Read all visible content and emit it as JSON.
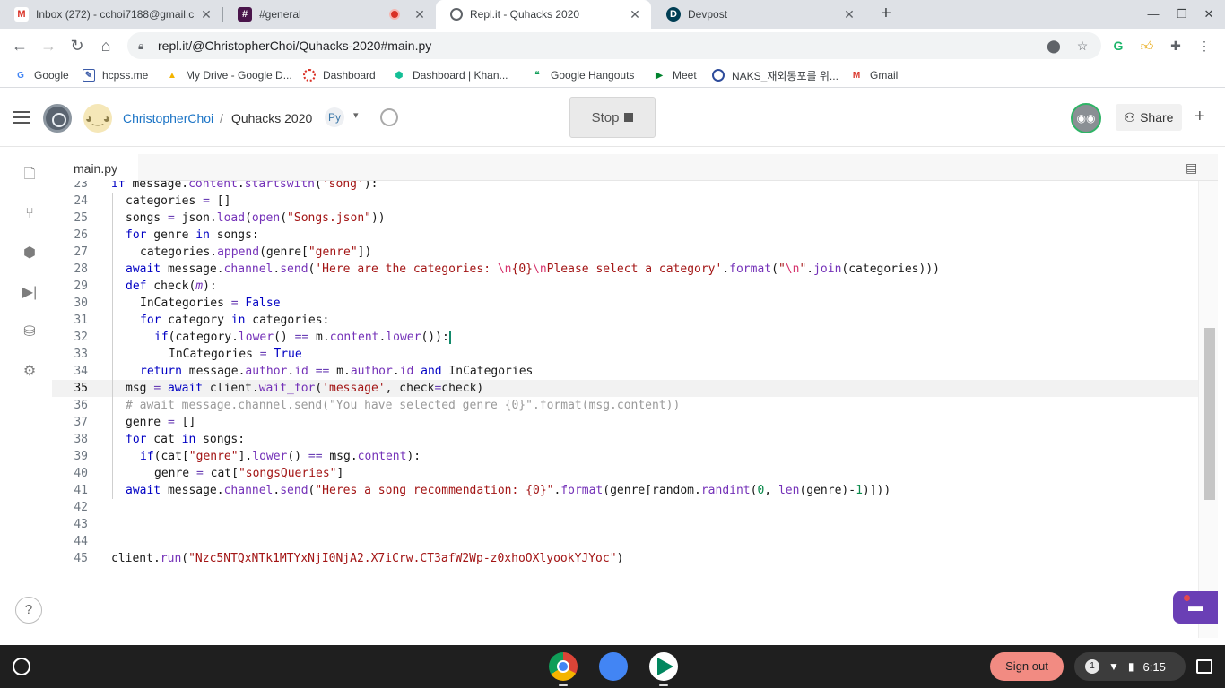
{
  "browser": {
    "tabs": [
      {
        "title": "Inbox (272) - cchoi7188@gmail.c"
      },
      {
        "title": "#general"
      },
      {
        "title": "Repl.it - Quhacks 2020"
      },
      {
        "title": "Devpost"
      }
    ],
    "url": "repl.it/@ChristopherChoi/Quhacks-2020#main.py",
    "bookmarks": [
      {
        "label": "Google"
      },
      {
        "label": "hcpss.me"
      },
      {
        "label": "My Drive - Google D..."
      },
      {
        "label": "Dashboard"
      },
      {
        "label": "Dashboard | Khan..."
      },
      {
        "label": "Google Hangouts"
      },
      {
        "label": "Meet"
      },
      {
        "label": "NAKS_재외동포를 위..."
      },
      {
        "label": "Gmail"
      }
    ],
    "colors": {
      "tabstrip": "#dee1e6",
      "active_tab": "#ffffff"
    }
  },
  "repl": {
    "username": "ChristopherChoi",
    "separator": "/",
    "project": "Quhacks 2020",
    "stop_label": "Stop",
    "share_label": "Share",
    "file_tab": "main.py",
    "accent": "#1a73c5"
  },
  "editor": {
    "current_line": "35",
    "lines": [
      {
        "num": "23",
        "text": "if message.content.startswith('song'):"
      },
      {
        "num": "24",
        "text": "categories = []"
      },
      {
        "num": "25",
        "text": "songs = json.load(open(\"Songs.json\"))"
      },
      {
        "num": "26",
        "text": "for genre in songs:"
      },
      {
        "num": "27",
        "text": "categories.append(genre[\"genre\"])"
      },
      {
        "num": "28",
        "text": "await message.channel.send('Here are the categories: \\n{0}\\nPlease select a category'.format(\"\\n\".join(categories)))"
      },
      {
        "num": "29",
        "text": "def check(m):"
      },
      {
        "num": "30",
        "text": "InCategories = False"
      },
      {
        "num": "31",
        "text": "for category in categories:"
      },
      {
        "num": "32",
        "text": "if(category.lower() == m.content.lower()):"
      },
      {
        "num": "33",
        "text": "InCategories = True"
      },
      {
        "num": "34",
        "text": "return message.author.id == m.author.id and InCategories"
      },
      {
        "num": "35",
        "text": "msg = await client.wait_for('message', check=check)"
      },
      {
        "num": "36",
        "text": "# await message.channel.send(\"You have selected genre {0}\".format(msg.content))"
      },
      {
        "num": "37",
        "text": "genre = []"
      },
      {
        "num": "38",
        "text": "for cat in songs:"
      },
      {
        "num": "39",
        "text": "if(cat[\"genre\"].lower() == msg.content):"
      },
      {
        "num": "40",
        "text": "genre = cat[\"songsQueries\"]"
      },
      {
        "num": "41",
        "text": "await message.channel.send(\"Heres a song recommendation: {0}\".format(genre[random.randint(0, len(genre)-1)]))"
      },
      {
        "num": "42",
        "text": ""
      },
      {
        "num": "43",
        "text": ""
      },
      {
        "num": "44",
        "text": ""
      },
      {
        "num": "45",
        "text": "client.run(\"Nzc5NTQxNTk1MTYxNjI0NjA2.X7iCrw.CT3afW2Wp-z0xhoOXlyookYJYoc\")"
      }
    ]
  },
  "shelf": {
    "signout_label": "Sign out",
    "notification_count": "1",
    "time": "6:15"
  }
}
